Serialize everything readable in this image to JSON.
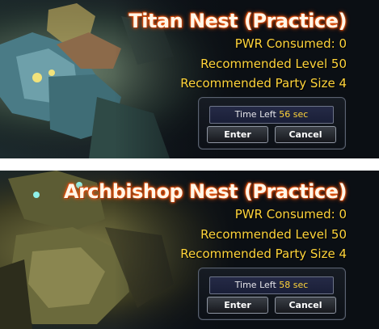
{
  "dialogs": [
    {
      "title": "Titan Nest (Practice)",
      "pwr": "PWR Consumed: 0",
      "level": "Recommended Level 50",
      "party": "Recommended Party Size 4",
      "time_label": "Time Left",
      "time_value": "56 sec",
      "enter": "Enter",
      "cancel": "Cancel"
    },
    {
      "title": "Archbishop Nest (Practice)",
      "pwr": "PWR Consumed: 0",
      "level": "Recommended Level 50",
      "party": "Recommended Party Size 4",
      "time_label": "Time Left",
      "time_value": "58 sec",
      "enter": "Enter",
      "cancel": "Cancel"
    }
  ],
  "colors": {
    "info_text": "#ffd43a",
    "title_glow": "#ff6a1a",
    "timer_bg": "#252a46"
  }
}
